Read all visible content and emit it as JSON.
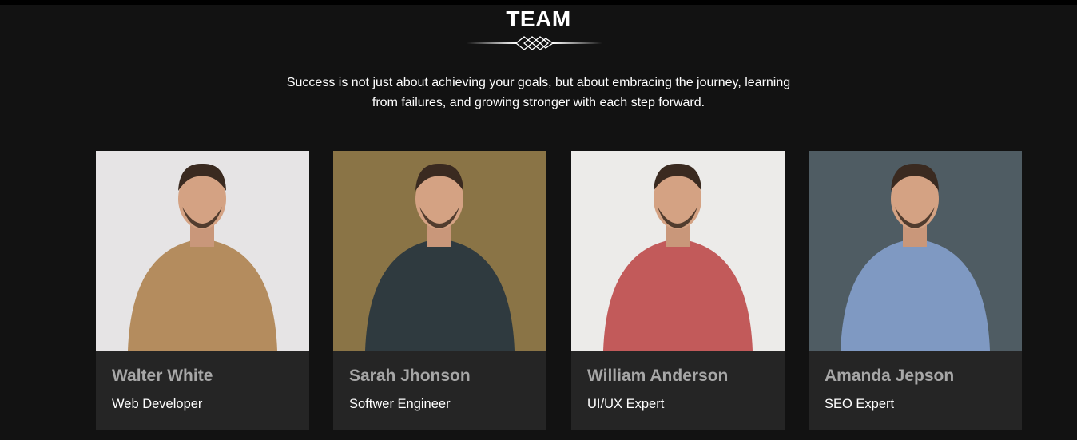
{
  "section": {
    "title": "TEAM",
    "subtitle": "Success is not just about achieving your goals, but about embracing the journey, learning from failures, and growing stronger with each step forward."
  },
  "members": [
    {
      "name": "Walter White",
      "role": "Web Developer",
      "photo_bg": "#e6e4e5",
      "shirt": "#b48c5e",
      "photo_icon": "person-photo"
    },
    {
      "name": "Sarah Jhonson",
      "role": "Softwer Engineer",
      "photo_bg": "#8a7446",
      "shirt": "#2f3a3f",
      "photo_icon": "person-photo"
    },
    {
      "name": "William Anderson",
      "role": "UI/UX Expert",
      "photo_bg": "#ecebe9",
      "shirt": "#c25a5a",
      "photo_icon": "person-photo"
    },
    {
      "name": "Amanda Jepson",
      "role": "SEO Expert",
      "photo_bg": "#4f5c63",
      "shirt": "#7f99c2",
      "photo_icon": "person-photo"
    }
  ],
  "colors": {
    "page_bg": "#121212",
    "card_bg": "#252525",
    "name_text": "#a7a7a7",
    "role_text": "#ffffff"
  }
}
